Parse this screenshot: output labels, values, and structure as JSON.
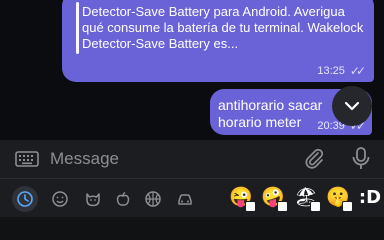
{
  "chat": {
    "link_preview_text": "Detector-Save Battery para Android. Averigua qué consume la batería de tu terminal. Wakelock Detector-Save Battery es...",
    "link_preview_time": "13:25",
    "outgoing_message_text": "antihorario sacar horario meter",
    "outgoing_message_time": "20:39"
  },
  "composer": {
    "placeholder": "Message",
    "icons": [
      "keyboard-icon",
      "paperclip-icon",
      "microphone-icon"
    ]
  },
  "emoji_panel": {
    "categories": [
      "recent-icon",
      "smileys-icon",
      "animals-icon",
      "food-icon",
      "sports-icon",
      "travel-icon"
    ],
    "stickers": [
      "😜",
      "🤪",
      "🏖",
      "🤫"
    ],
    "sticker_text": ":D"
  },
  "colors": {
    "outgoing_bubble": "#6a63d8",
    "background": "#0b0c10",
    "panel": "#1c1d21"
  }
}
